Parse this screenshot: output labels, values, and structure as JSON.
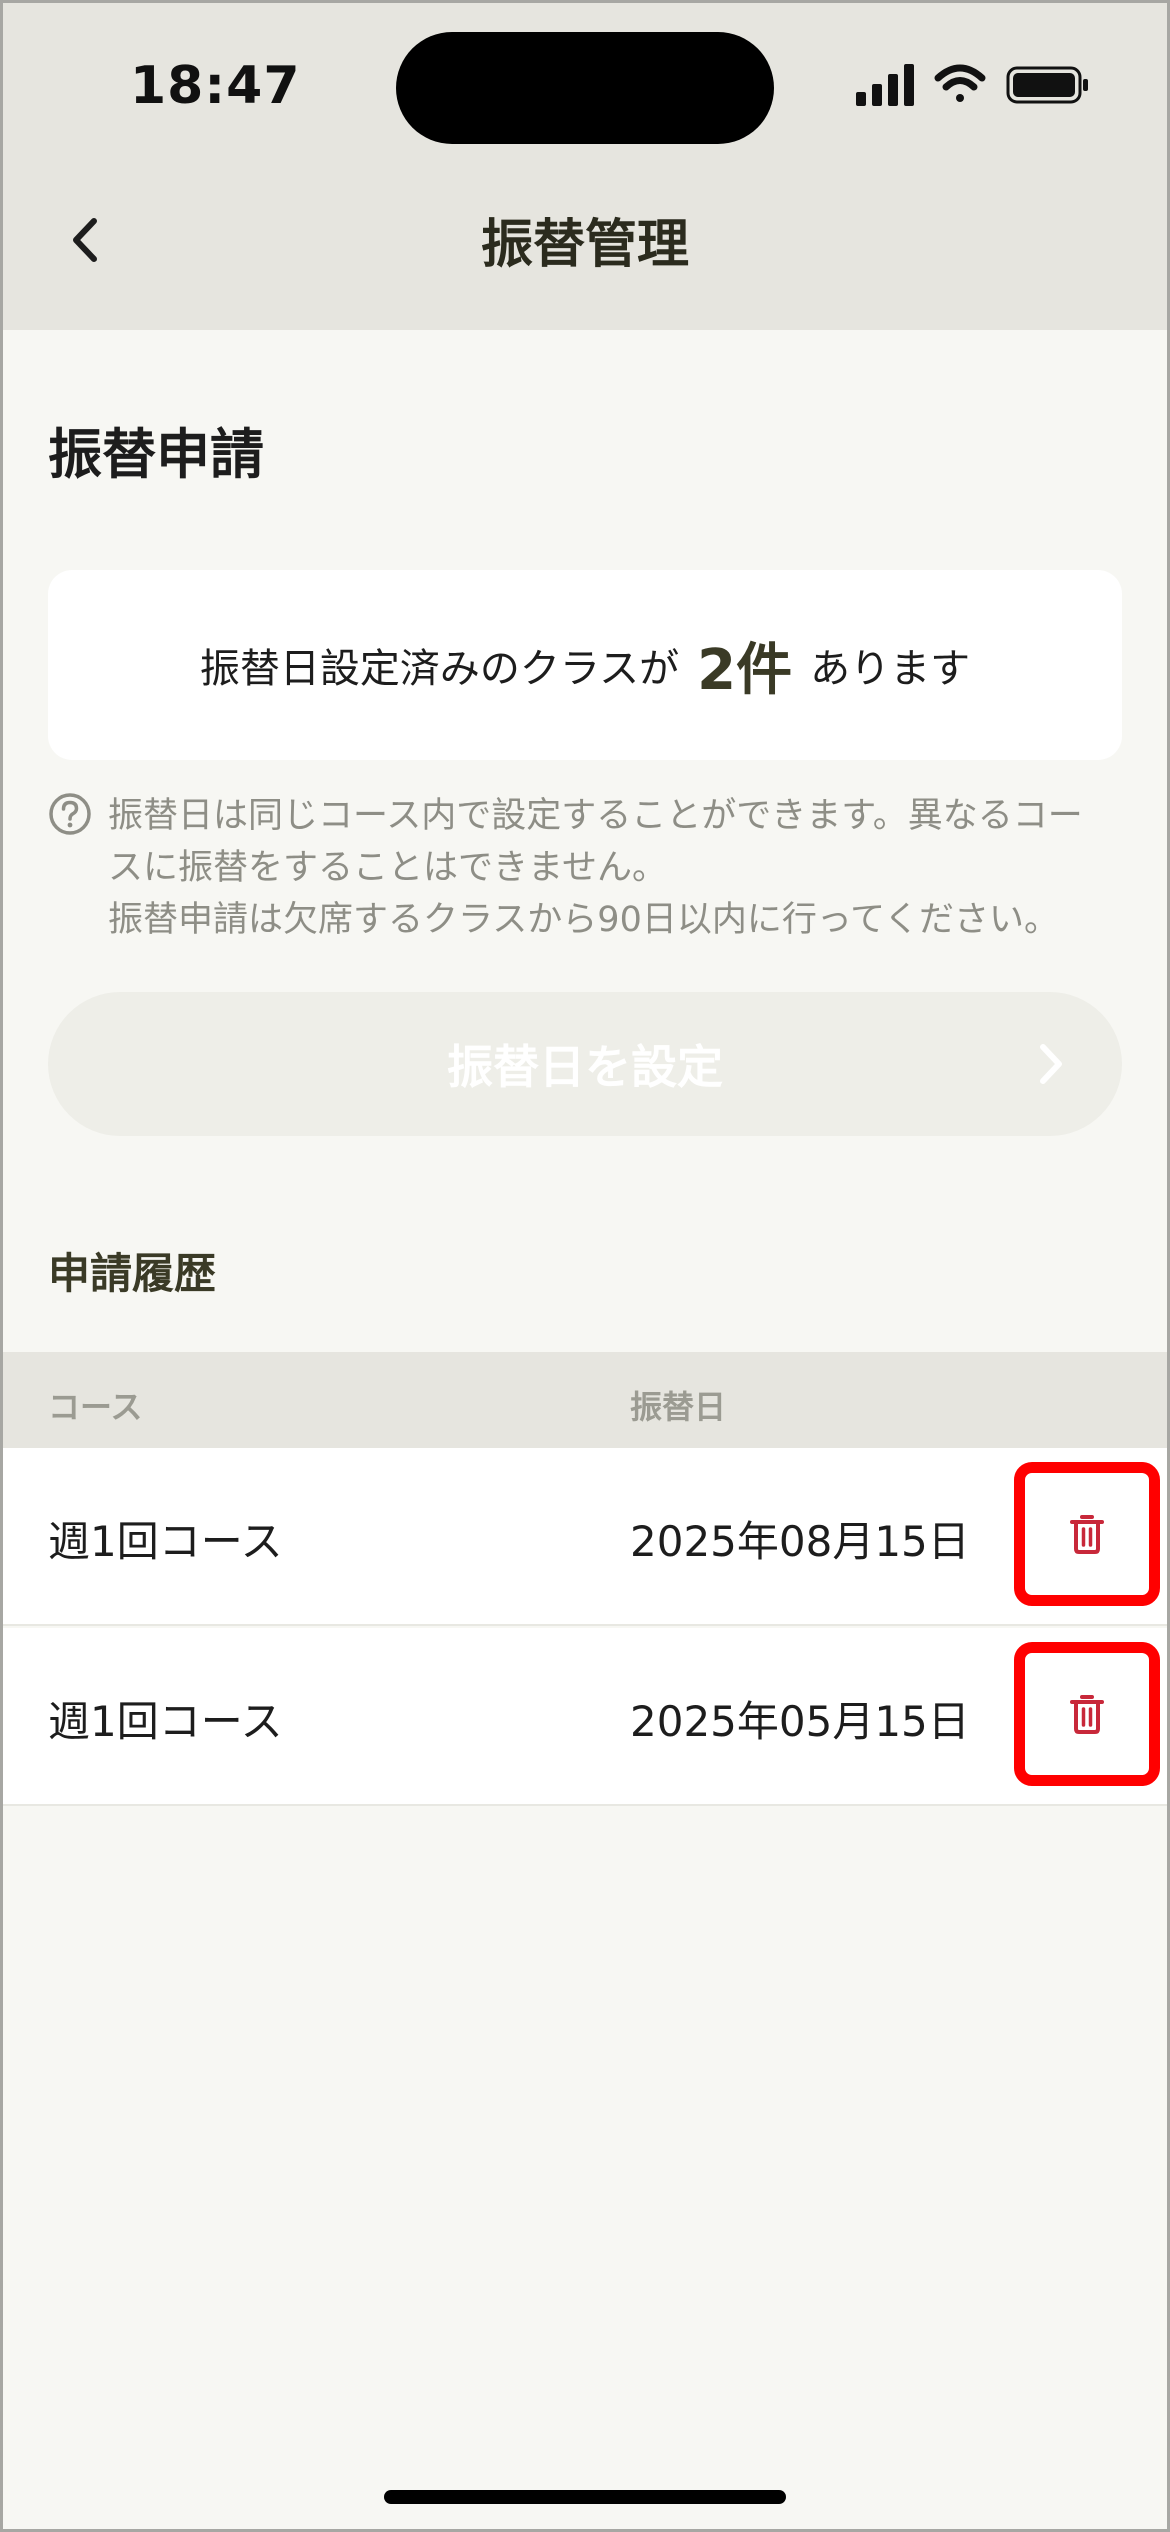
{
  "status_bar": {
    "time": "18:47"
  },
  "nav": {
    "title": "振替管理"
  },
  "section": {
    "title": "振替申請"
  },
  "summary": {
    "text_before": "振替日設定済みのクラスが",
    "count": "2件",
    "text_after": "あります"
  },
  "info": {
    "lines": [
      "振替日は同じコース内で設定することができます。異なるコー",
      "スに振替をすることはできません。",
      "振替申請は欠席するクラスから90日以内に行ってください。"
    ]
  },
  "action_button": {
    "label": "振替日を設定"
  },
  "history": {
    "title": "申請履歴",
    "columns": [
      "コース",
      "振替日"
    ],
    "rows": [
      {
        "course": "週1回コース",
        "date": "2025年08月15日"
      },
      {
        "course": "週1回コース",
        "date": "2025年05月15日"
      }
    ]
  },
  "colors": {
    "header_bg": "#e6e5df",
    "page_bg": "#f7f7f3",
    "delete_icon": "#c8283a",
    "highlight": "#ff0000"
  }
}
